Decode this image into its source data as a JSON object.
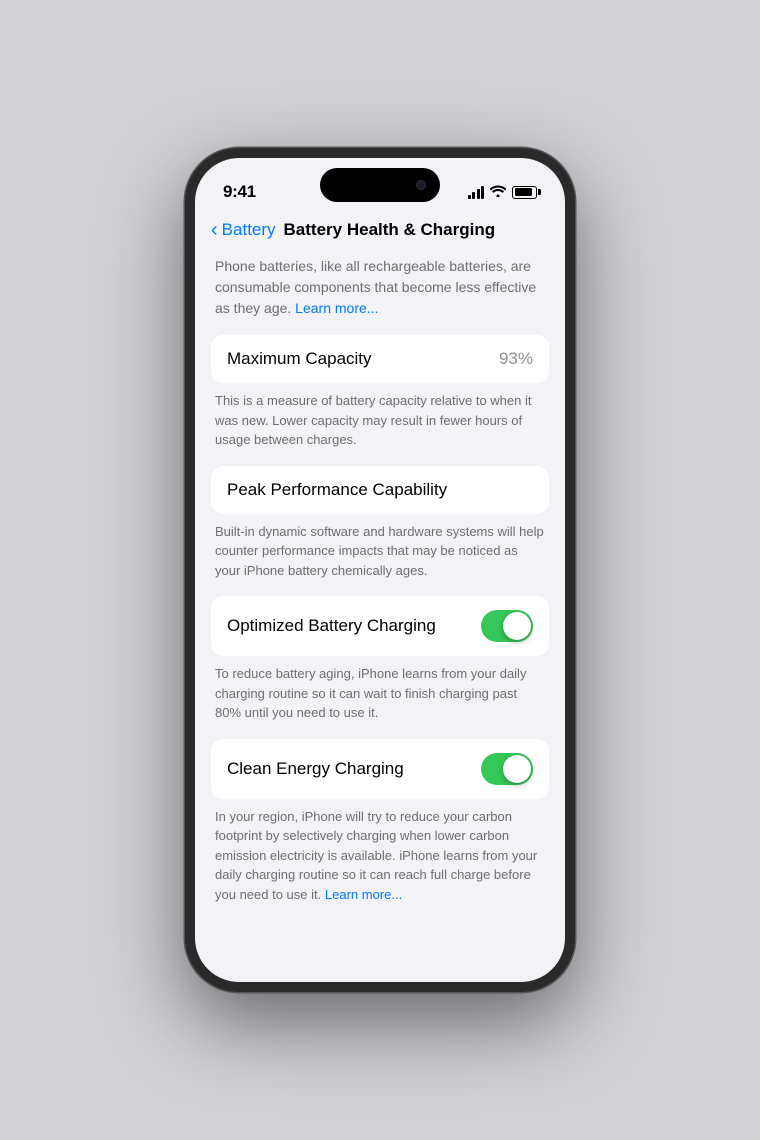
{
  "statusBar": {
    "time": "9:41",
    "signalBars": [
      5,
      8,
      11,
      13
    ],
    "batteryPercent": 85
  },
  "nav": {
    "backLabel": "Battery",
    "pageTitle": "Battery Health & Charging"
  },
  "introText": "Phone batteries, like all rechargeable batteries, are consumable components that become less effective as they age.",
  "introLearnMore": "Learn more...",
  "sections": [
    {
      "id": "maximum-capacity",
      "label": "Maximum Capacity",
      "value": "93%",
      "description": "This is a measure of battery capacity relative to when it was new. Lower capacity may result in fewer hours of usage between charges.",
      "hasToggle": false
    },
    {
      "id": "peak-performance",
      "label": "Peak Performance Capability",
      "value": null,
      "description": "Built-in dynamic software and hardware systems will help counter performance impacts that may be noticed as your iPhone battery chemically ages.",
      "hasToggle": false
    },
    {
      "id": "optimized-charging",
      "label": "Optimized Battery Charging",
      "value": null,
      "description": "To reduce battery aging, iPhone learns from your daily charging routine so it can wait to finish charging past 80% until you need to use it.",
      "hasToggle": true,
      "toggleOn": true
    },
    {
      "id": "clean-energy",
      "label": "Clean Energy Charging",
      "value": null,
      "description": "In your region, iPhone will try to reduce your carbon footprint by selectively charging when lower carbon emission electricity is available. iPhone learns from your daily charging routine so it can reach full charge before you need to use it.",
      "hasLearnMore": true,
      "learnMoreLabel": "Learn more...",
      "hasToggle": true,
      "toggleOn": true
    }
  ]
}
